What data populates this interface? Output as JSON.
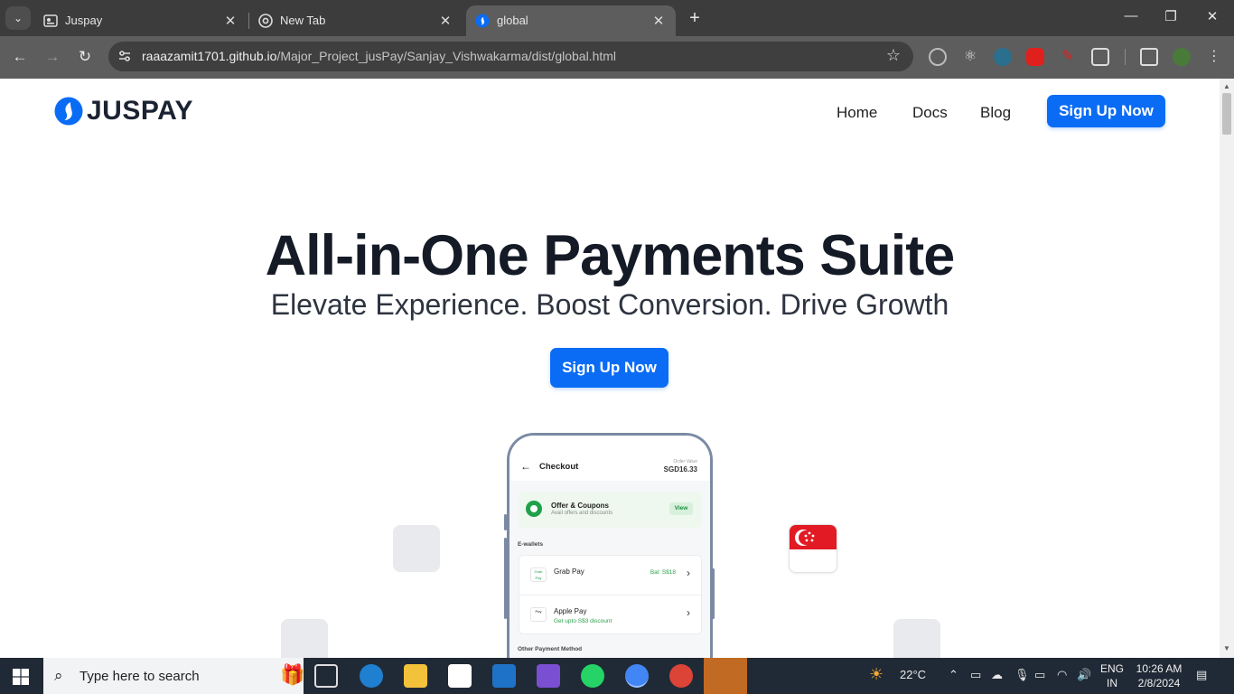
{
  "browser": {
    "tabs": [
      {
        "title": "Juspay",
        "close": "✕"
      },
      {
        "title": "New Tab",
        "close": "✕"
      },
      {
        "title": "global",
        "close": "✕"
      }
    ],
    "new_tab": "+",
    "url_host": "raaazamit1701.github.io",
    "url_path": "/Major_Project_jusPay/Sanjay_Vishwakarma/dist/global.html"
  },
  "page": {
    "logo_text": "JUSPAY",
    "nav": {
      "home": "Home",
      "docs": "Docs",
      "blog": "Blog",
      "cta": "Sign Up Now"
    },
    "hero": {
      "title": "All-in-One Payments Suite",
      "subtitle": "Elevate Experience. Boost Conversion. Drive Growth",
      "cta": "Sign Up Now"
    },
    "colors": {
      "primary": "#0a6cf5",
      "heading": "#151b26"
    },
    "phone": {
      "title": "Checkout",
      "order_value_label": "Order Value",
      "order_value": "SGD16.33",
      "offer_title": "Offer & Coupons",
      "offer_sub": "Avail offers and discounts",
      "offer_view": "View",
      "ewallets_label": "E-wallets",
      "wallets": [
        {
          "name": "Grab Pay",
          "logo": "Grab Pay",
          "extra": "Bal: S$18"
        },
        {
          "name": "Apple Pay",
          "logo": "Pay",
          "extra": "Get upto S$3 discount"
        }
      ],
      "other_label": "Other Payment Method"
    }
  },
  "taskbar": {
    "search_placeholder": "Type here to search",
    "weather": "22°C",
    "lang_1": "ENG",
    "lang_2": "IN",
    "time": "10:26 AM",
    "date": "2/8/2024"
  }
}
